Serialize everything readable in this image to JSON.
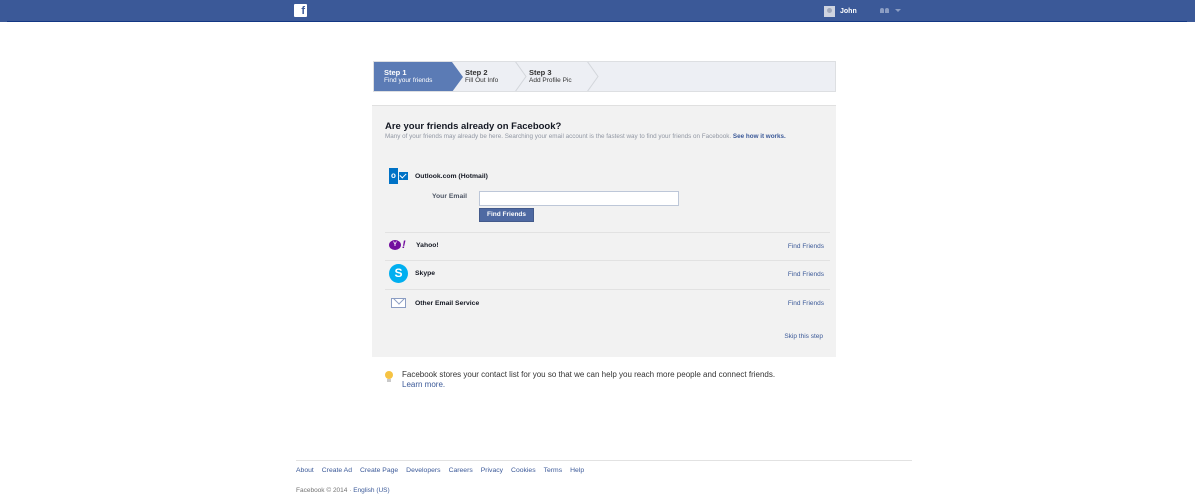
{
  "topbar": {
    "logo": "f",
    "user_name": "John"
  },
  "wizard": {
    "steps": [
      {
        "title": "Step 1",
        "subtitle": "Find your friends"
      },
      {
        "title": "Step 2",
        "subtitle": "Fill Out Info"
      },
      {
        "title": "Step 3",
        "subtitle": "Add Profile Pic"
      }
    ]
  },
  "panel": {
    "heading": "Are your friends already on Facebook?",
    "intro": "Many of your friends may already be here. Searching your email account is the fastest way to find your friends on Facebook.",
    "intro_link": "See how it works.",
    "outlook_label": "Outlook.com (Hotmail)",
    "email_label": "Your Email",
    "email_value": "",
    "email_placeholder": "",
    "find_button": "Find Friends",
    "services": [
      {
        "name": "Yahoo!",
        "action": "Find Friends"
      },
      {
        "name": "Skype",
        "action": "Find Friends"
      },
      {
        "name": "Other Email Service",
        "action": "Find Friends"
      }
    ],
    "skip": "Skip this step"
  },
  "tip": {
    "text": "Facebook stores your contact list for you so that we can help you reach more people and connect friends.",
    "link": "Learn more."
  },
  "footer": {
    "links": [
      "About",
      "Create Ad",
      "Create Page",
      "Developers",
      "Careers",
      "Privacy",
      "Cookies",
      "Terms",
      "Help"
    ],
    "copyright": "Facebook © 2014 ·",
    "language": "English (US)"
  },
  "colors": {
    "brand": "#3b5998",
    "active_step": "#5b7bb5",
    "button": "#4e69a2",
    "panel_bg": "#f2f2f2"
  }
}
